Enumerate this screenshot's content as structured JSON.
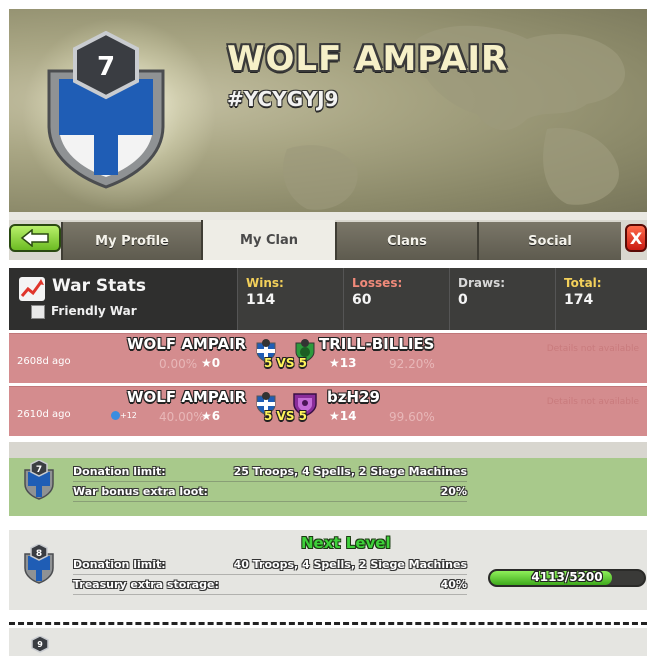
{
  "header": {
    "clan_name": "WOLF AMPAIR",
    "clan_tag": "#YCYGYJ9",
    "clan_level": "7"
  },
  "tabs": [
    {
      "label": "My Profile",
      "active": false
    },
    {
      "label": "My Clan",
      "active": true
    },
    {
      "label": "Clans",
      "active": false
    },
    {
      "label": "Social",
      "active": false
    }
  ],
  "close_label": "X",
  "war_stats": {
    "title": "War Stats",
    "friendly_war_label": "Friendly War",
    "wins_label": "Wins:",
    "wins": "114",
    "losses_label": "Losses:",
    "losses": "60",
    "draws_label": "Draws:",
    "draws": "0",
    "total_label": "Total:",
    "total": "174",
    "colors": {
      "wins": "#f3d05a",
      "losses": "#f08a7a",
      "draws": "#d8d8d8",
      "total": "#f3d05a"
    }
  },
  "war_log": [
    {
      "ago": "2608d ago",
      "clan_a": "WOLF AMPAIR",
      "clan_b": "TRILL-BILLIES",
      "pct_a": "0.00%",
      "stars_a": "0",
      "vs": "5 VS 5",
      "stars_b": "13",
      "pct_b": "92.20%",
      "details": "Details not available",
      "xp": ""
    },
    {
      "ago": "2610d ago",
      "clan_a": "WOLF AMPAIR",
      "clan_b": "bzH29",
      "pct_a": "40.00%",
      "stars_a": "6",
      "vs": "5 VS 5",
      "stars_b": "14",
      "pct_b": "99.60%",
      "details": "Details not available",
      "xp": "+12"
    }
  ],
  "levels": {
    "current": {
      "level": "7",
      "donation_label": "Donation limit:",
      "donation_value": "25 Troops, 4 Spells, 2 Siege Machines",
      "bonus_label": "War bonus extra loot:",
      "bonus_value": "20%"
    },
    "next": {
      "heading": "Next Level",
      "level": "8",
      "donation_label": "Donation limit:",
      "donation_value": "40 Troops, 4 Spells, 2 Siege Machines",
      "storage_label": "Treasury extra storage:",
      "storage_value": "40%",
      "progress_text": "4113/5200",
      "progress_fraction": 0.791
    },
    "following": {
      "level": "9"
    }
  }
}
